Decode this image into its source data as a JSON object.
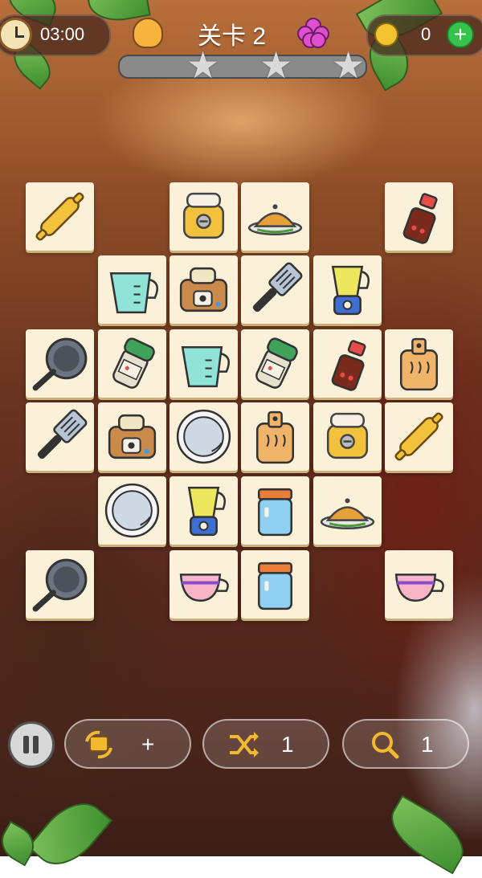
{
  "header": {
    "timer": "03:00",
    "level": "关卡 2",
    "coins": "0",
    "progress_stars": 3
  },
  "tiles": [
    {
      "row": 0,
      "col": 0,
      "item": "rolling-pin"
    },
    {
      "row": 0,
      "col": 2,
      "item": "rice-cooker"
    },
    {
      "row": 0,
      "col": 3,
      "item": "roast-dish"
    },
    {
      "row": 0,
      "col": 5,
      "item": "sauce-bottle"
    },
    {
      "row": 1,
      "col": 1,
      "item": "measuring-cup"
    },
    {
      "row": 1,
      "col": 2,
      "item": "toaster"
    },
    {
      "row": 1,
      "col": 3,
      "item": "spatula"
    },
    {
      "row": 1,
      "col": 4,
      "item": "blender"
    },
    {
      "row": 2,
      "col": 0,
      "item": "frying-pan"
    },
    {
      "row": 2,
      "col": 1,
      "item": "spice-jar"
    },
    {
      "row": 2,
      "col": 2,
      "item": "measuring-cup"
    },
    {
      "row": 2,
      "col": 3,
      "item": "spice-jar"
    },
    {
      "row": 2,
      "col": 4,
      "item": "sauce-bottle"
    },
    {
      "row": 2,
      "col": 5,
      "item": "cutting-board"
    },
    {
      "row": 3,
      "col": 0,
      "item": "spatula"
    },
    {
      "row": 3,
      "col": 1,
      "item": "toaster"
    },
    {
      "row": 3,
      "col": 2,
      "item": "plate"
    },
    {
      "row": 3,
      "col": 3,
      "item": "cutting-board"
    },
    {
      "row": 3,
      "col": 4,
      "item": "rice-cooker"
    },
    {
      "row": 3,
      "col": 5,
      "item": "rolling-pin"
    },
    {
      "row": 4,
      "col": 1,
      "item": "plate"
    },
    {
      "row": 4,
      "col": 2,
      "item": "blender"
    },
    {
      "row": 4,
      "col": 3,
      "item": "jar"
    },
    {
      "row": 4,
      "col": 4,
      "item": "roast-dish"
    },
    {
      "row": 5,
      "col": 0,
      "item": "frying-pan"
    },
    {
      "row": 5,
      "col": 2,
      "item": "teacup"
    },
    {
      "row": 5,
      "col": 3,
      "item": "jar"
    },
    {
      "row": 5,
      "col": 5,
      "item": "teacup"
    }
  ],
  "toolbar": {
    "undo_label": "+",
    "shuffle_count": "1",
    "hint_count": "1"
  }
}
